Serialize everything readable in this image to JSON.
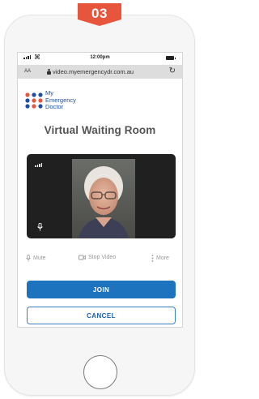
{
  "step_badge": {
    "number": "03",
    "color": "#e8553d"
  },
  "status_bar": {
    "time": "12:00pm",
    "signal_icon": "signal-bars-icon",
    "wifi_icon": "wifi-icon",
    "battery_icon": "battery-icon"
  },
  "browser": {
    "text_size": "AA",
    "url": "video.myemergencydr.com.au",
    "lock_icon": "lock-icon",
    "reload_icon": "reload-icon"
  },
  "brand": {
    "line1": "My",
    "line2": "Emergency",
    "line3": "Doctor",
    "color": "#1e4fa3",
    "accent": "#e8553d"
  },
  "page": {
    "title": "Virtual Waiting Room"
  },
  "video": {
    "signal_icon": "signal-bars-icon",
    "mic_icon": "microphone-icon"
  },
  "controls": {
    "mute": "Mute",
    "stop_video": "Stop Video",
    "more": "More"
  },
  "actions": {
    "join": "JOIN",
    "cancel": "CANCEL",
    "primary_color": "#1e73be"
  }
}
